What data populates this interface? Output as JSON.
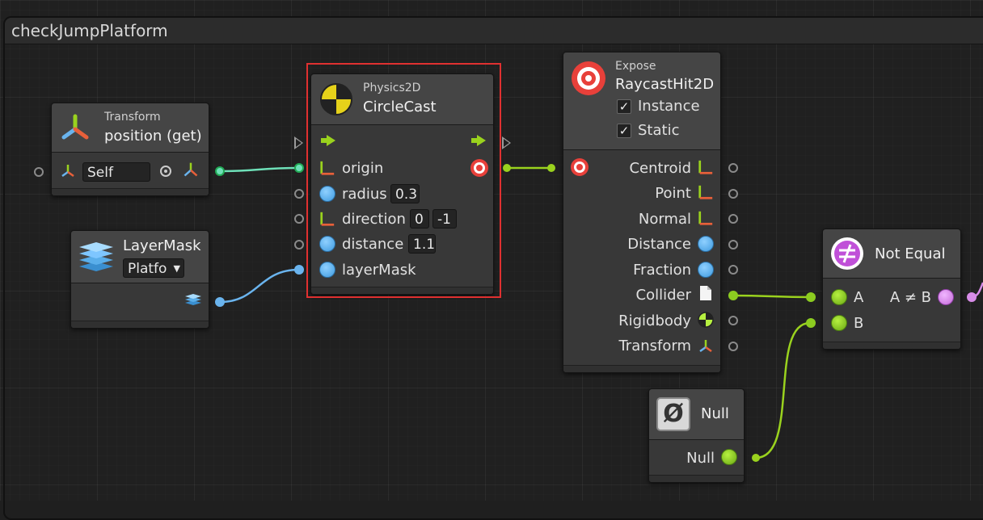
{
  "group": {
    "title": "checkJumpPlatform"
  },
  "transform_node": {
    "category": "Transform",
    "title": "position (get)",
    "field": "Self"
  },
  "layermask_node": {
    "title": "LayerMask",
    "dropdown": "Platfo"
  },
  "circlecast_node": {
    "category": "Physics2D",
    "title": "CircleCast",
    "inputs": {
      "origin": "origin",
      "radius": "radius",
      "direction": "direction",
      "distance": "distance",
      "layerMask": "layerMask"
    },
    "values": {
      "radius": "0.3",
      "direction_x": "0",
      "direction_y": "-1",
      "distance": "1.1"
    }
  },
  "expose_node": {
    "category": "Expose",
    "title": "RaycastHit2D",
    "instance_label": "Instance",
    "static_label": "Static",
    "outputs": [
      "Centroid",
      "Point",
      "Normal",
      "Distance",
      "Fraction",
      "Collider",
      "Rigidbody",
      "Transform"
    ]
  },
  "notequal_node": {
    "title": "Not Equal",
    "input_a": "A",
    "input_b": "B",
    "output": "A ≠ B"
  },
  "null_node": {
    "title": "Null",
    "output": "Null",
    "icon_glyph": "Ø"
  },
  "colors": {
    "selection": "#e03030",
    "wire_green": "#9ad21e",
    "wire_teal": "#6ee0b8",
    "wire_blue": "#6ab4ee"
  }
}
